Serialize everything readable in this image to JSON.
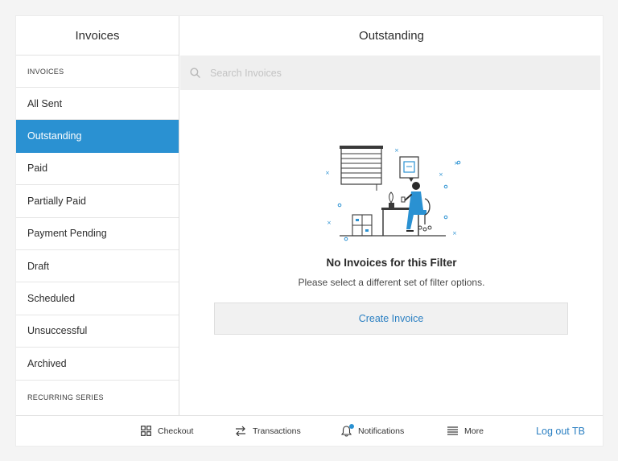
{
  "sidebar": {
    "title": "Invoices",
    "section_invoices": "INVOICES",
    "items": [
      {
        "label": "All Sent",
        "active": false
      },
      {
        "label": "Outstanding",
        "active": true
      },
      {
        "label": "Paid",
        "active": false
      },
      {
        "label": "Partially Paid",
        "active": false
      },
      {
        "label": "Payment Pending",
        "active": false
      },
      {
        "label": "Draft",
        "active": false
      },
      {
        "label": "Scheduled",
        "active": false
      },
      {
        "label": "Unsuccessful",
        "active": false
      },
      {
        "label": "Archived",
        "active": false
      }
    ],
    "section_recurring": "RECURRING SERIES"
  },
  "main": {
    "title": "Outstanding",
    "search": {
      "placeholder": "Search Invoices",
      "value": "",
      "icon": "search-icon"
    },
    "empty_state": {
      "title": "No Invoices for this Filter",
      "subtitle": "Please select a different set of filter options.",
      "illustration": "person-at-desk-illustration"
    },
    "create_button": "Create Invoice"
  },
  "bottombar": {
    "tabs": [
      {
        "label": "Checkout",
        "icon": "grid-icon"
      },
      {
        "label": "Transactions",
        "icon": "swap-arrows-icon"
      },
      {
        "label": "Notifications",
        "icon": "bell-icon",
        "has_badge": true
      },
      {
        "label": "More",
        "icon": "menu-icon"
      }
    ],
    "logout": "Log out TB"
  },
  "colors": {
    "accent": "#2a91d2",
    "link": "#2a7fc2",
    "search_bg": "#efefef",
    "button_bg": "#f1f1f1"
  }
}
